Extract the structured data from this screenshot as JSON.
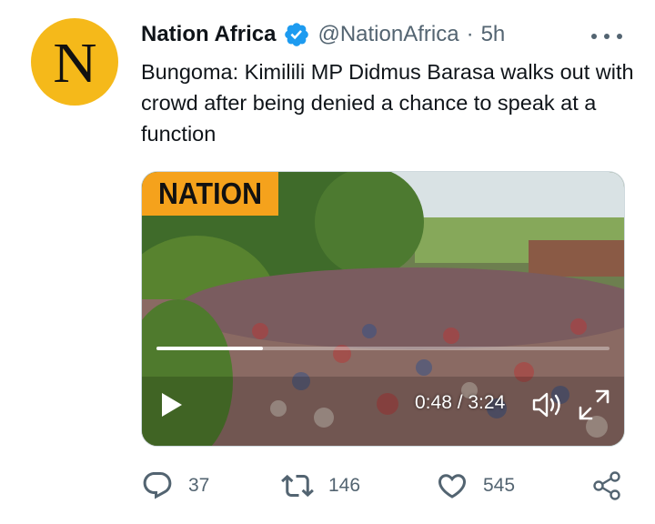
{
  "tweet": {
    "avatar_letter": "N",
    "author_name": "Nation Africa",
    "handle": "@NationAfrica",
    "separator": "·",
    "time": "5h",
    "text": "Bungoma: Kimilili MP Didmus Barasa walks out with crowd after being denied a chance to speak at a function"
  },
  "video": {
    "logo_text": "NATION",
    "current_time": "0:48",
    "duration": "3:24",
    "time_display": "0:48 / 3:24",
    "progress_fraction": 0.235
  },
  "actions": {
    "replies": "37",
    "retweets": "146",
    "likes": "545"
  },
  "icons": [
    "verified-badge-icon",
    "more-icon",
    "play-icon",
    "volume-icon",
    "fullscreen-icon",
    "reply-icon",
    "retweet-icon",
    "like-icon",
    "share-icon"
  ],
  "colors": {
    "verified_blue": "#1d9bf0",
    "secondary_text": "#536471",
    "avatar_bg": "#f5b91a",
    "nation_logo_bg": "#f5a21c"
  }
}
